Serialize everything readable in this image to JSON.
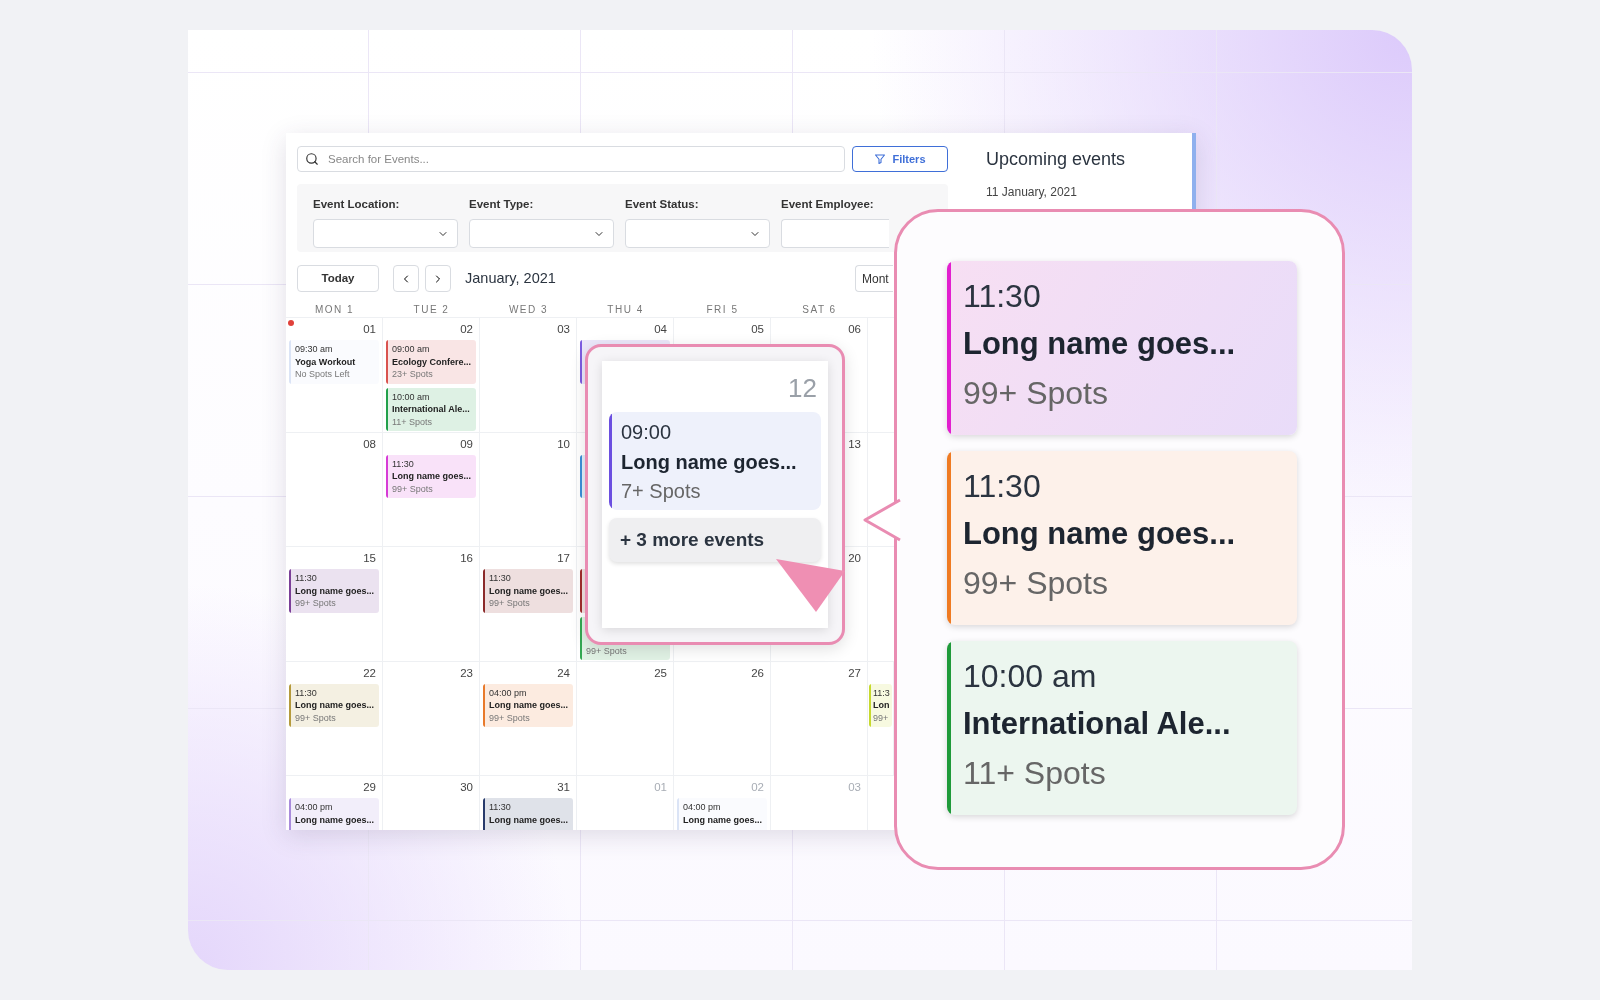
{
  "search": {
    "placeholder": "Search for Events..."
  },
  "filters_button": "Filters",
  "filters": [
    {
      "label": "Event Location:"
    },
    {
      "label": "Event Type:"
    },
    {
      "label": "Event Status:"
    },
    {
      "label": "Event Employee:"
    }
  ],
  "toolbar": {
    "today": "Today",
    "month": "January, 2021",
    "view": "Mont"
  },
  "day_headers": [
    "MON 1",
    "TUE 2",
    "WED 3",
    "THU 4",
    "FRI 5",
    "SAT 6"
  ],
  "weeks": [
    {
      "days": [
        {
          "kind": "day",
          "date": "01",
          "today": true,
          "muted": false,
          "events": [
            {
              "time": "09:30 am",
              "title": "Yoga Workout",
              "spots": "No Spots Left",
              "color": "#dbe4f6"
            }
          ]
        },
        {
          "kind": "day",
          "date": "02",
          "muted": false,
          "events": [
            {
              "time": "09:00 am",
              "title": "Ecology Confere...",
              "spots": "23+ Spots",
              "color": "#d9534f"
            },
            {
              "time": "10:00 am",
              "title": "International Ale...",
              "spots": "11+ Spots",
              "color": "#22a04b"
            }
          ]
        },
        {
          "kind": "day",
          "date": "03",
          "muted": false
        },
        {
          "kind": "day",
          "date": "04",
          "muted": false,
          "events": [
            {
              "color": "#7c5ce0"
            }
          ]
        },
        {
          "kind": "day",
          "date": "05",
          "muted": false
        },
        {
          "kind": "day",
          "date": "06",
          "muted": false
        }
      ]
    },
    {
      "days": [
        {
          "kind": "day",
          "date": "08",
          "muted": false
        },
        {
          "kind": "day",
          "date": "09",
          "muted": false,
          "events": [
            {
              "time": "11:30",
              "title": "Long name goes...",
              "spots": "99+ Spots",
              "color": "#d63bd6"
            }
          ]
        },
        {
          "kind": "day",
          "date": "10",
          "muted": false
        },
        {
          "kind": "day",
          "events": [
            {
              "color": "#3b8fd8"
            }
          ]
        },
        {
          "kind": "blank"
        },
        {
          "kind": "day",
          "date": "13",
          "muted": false
        }
      ]
    },
    {
      "days": [
        {
          "kind": "day",
          "date": "15",
          "muted": false,
          "events": [
            {
              "time": "11:30",
              "title": "Long name goes...",
              "spots": "99+ Spots",
              "color": "#7b3f98"
            }
          ]
        },
        {
          "kind": "day",
          "date": "16",
          "muted": false
        },
        {
          "kind": "day",
          "date": "17",
          "muted": false,
          "events": [
            {
              "time": "11:30",
              "title": "Long name goes...",
              "spots": "99+ Spots",
              "color": "#8b2a2a"
            }
          ]
        },
        {
          "kind": "day",
          "events": [
            {
              "color": "#a02c2c"
            },
            {
              "spots": "99+ Spots",
              "color": "#34a853"
            }
          ]
        },
        {
          "kind": "blank"
        },
        {
          "kind": "day",
          "date": "20",
          "muted": false
        }
      ]
    },
    {
      "days": [
        {
          "kind": "day",
          "date": "22",
          "muted": false,
          "events": [
            {
              "time": "11:30",
              "title": "Long name goes...",
              "spots": "99+ Spots",
              "color": "#b59a3c"
            }
          ]
        },
        {
          "kind": "day",
          "date": "23",
          "muted": false
        },
        {
          "kind": "day",
          "date": "24",
          "muted": false,
          "events": [
            {
              "time": "04:00 pm",
              "title": "Long name goes...",
              "spots": "99+ Spots",
              "color": "#e87a2c"
            }
          ]
        },
        {
          "kind": "day",
          "date": "25",
          "muted": false
        },
        {
          "kind": "day",
          "date": "26",
          "muted": false
        },
        {
          "kind": "day",
          "date": "27",
          "muted": false
        },
        {
          "kind": "day",
          "events": [
            {
              "time": "11:3",
              "title": "Lon",
              "spots": "99+",
              "color": "#c6d92d"
            }
          ]
        }
      ]
    },
    {
      "days": [
        {
          "kind": "day",
          "date": "29",
          "muted": false,
          "events": [
            {
              "time": "04:00 pm",
              "title": "Long name goes...",
              "color": "#a98bdc"
            }
          ]
        },
        {
          "kind": "day",
          "date": "30",
          "muted": false
        },
        {
          "kind": "day",
          "date": "31",
          "muted": false,
          "events": [
            {
              "time": "11:30",
              "title": "Long name goes...",
              "color": "#273a6b"
            }
          ]
        },
        {
          "kind": "day",
          "date": "01",
          "muted": true
        },
        {
          "kind": "day",
          "date": "02",
          "muted": true,
          "events": [
            {
              "time": "04:00 pm",
              "title": "Long name goes...",
              "color": "#dbe4f6"
            }
          ]
        },
        {
          "kind": "day",
          "date": "03",
          "muted": true
        }
      ]
    }
  ],
  "upcoming": {
    "title": "Upcoming events",
    "date": "11 January, 2021"
  },
  "day_popup": {
    "date": "12",
    "event": {
      "time": "09:00",
      "title": "Long name goes...",
      "spots": "7+ Spots",
      "color": "#6b4fe0"
    },
    "more": "+ 3 more events"
  },
  "event_zoom": [
    {
      "time": "11:30",
      "title": "Long name goes...",
      "spots": "99+ Spots",
      "color": "#e21fcf"
    },
    {
      "time": "11:30",
      "title": "Long name goes...",
      "spots": "99+ Spots",
      "color": "#ef7a22"
    },
    {
      "time": "10:00 am",
      "title": "International Ale...",
      "spots": "11+ Spots",
      "color": "#1f9a3a"
    }
  ]
}
